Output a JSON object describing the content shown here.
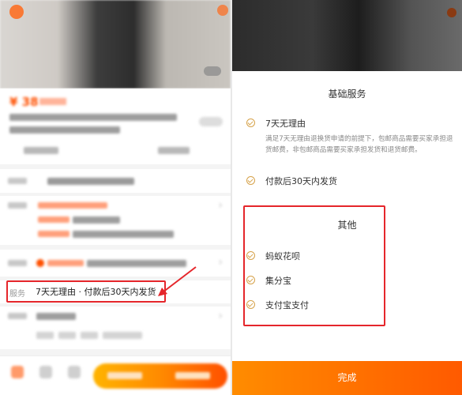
{
  "left_screen": {
    "price_display": "¥ 38",
    "service_row": {
      "label": "服务",
      "value": "7天无理由 · 付款后30天内发货"
    }
  },
  "right_screen": {
    "sheet_title": "基础服务",
    "basic_services": [
      {
        "title": "7天无理由",
        "description": "满足7天无理由退换货申请的前提下，包邮商品需要买家承担退货邮费，非包邮商品需要买家承担发货和退货邮费。"
      },
      {
        "title": "付款后30天内发货"
      }
    ],
    "other_section_title": "其他",
    "other_services": [
      "蚂蚁花呗",
      "集分宝",
      "支付宝支付"
    ],
    "done_button": "完成"
  },
  "colors": {
    "accent_orange": "#ff5000",
    "highlight_red": "#e5262b",
    "check_gold": "#d6a24a"
  }
}
